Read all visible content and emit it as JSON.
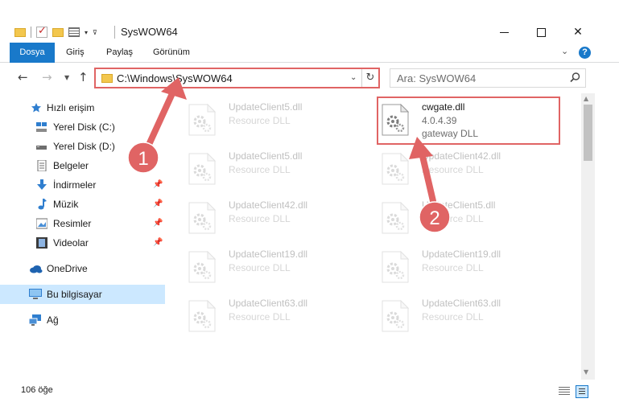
{
  "window": {
    "title": "SysWOW64"
  },
  "ribbon": {
    "tabs": [
      "Dosya",
      "Giriş",
      "Paylaş",
      "Görünüm"
    ]
  },
  "address": {
    "path": "C:\\Windows\\SysWOW64"
  },
  "search": {
    "placeholder": "Ara: SysWOW64"
  },
  "sidebar": {
    "items": [
      {
        "label": "Hızlı erişim",
        "icon": "star-icon",
        "pinned": false
      },
      {
        "label": "Yerel Disk (C:)",
        "icon": "drive-c-icon",
        "pinned": false
      },
      {
        "label": "Yerel Disk (D:)",
        "icon": "drive-icon",
        "pinned": false
      },
      {
        "label": "Belgeler",
        "icon": "documents-icon",
        "pinned": false
      },
      {
        "label": "İndirmeler",
        "icon": "downloads-icon",
        "pinned": true
      },
      {
        "label": "Müzik",
        "icon": "music-icon",
        "pinned": true
      },
      {
        "label": "Resimler",
        "icon": "pictures-icon",
        "pinned": true
      },
      {
        "label": "Videolar",
        "icon": "videos-icon",
        "pinned": true
      },
      {
        "label": "OneDrive",
        "icon": "cloud-icon",
        "pinned": false
      },
      {
        "label": "Bu bilgisayar",
        "icon": "computer-icon",
        "pinned": false,
        "selected": true
      },
      {
        "label": "Ağ",
        "icon": "network-icon",
        "pinned": false
      }
    ]
  },
  "files": {
    "left": [
      {
        "name": "UpdateClient5.dll",
        "type": "Resource DLL"
      },
      {
        "name": "UpdateClient5.dll",
        "type": "Resource DLL"
      },
      {
        "name": "UpdateClient42.dll",
        "type": "Resource DLL"
      },
      {
        "name": "UpdateClient19.dll",
        "type": "Resource DLL"
      },
      {
        "name": "UpdateClient63.dll",
        "type": "Resource DLL"
      }
    ],
    "right": [
      {
        "name": "cwgate.dll",
        "version": "4.0.4.39",
        "type": "gateway DLL",
        "highlighted": true
      },
      {
        "name": "UpdateClient42.dll",
        "type": "Resource DLL"
      },
      {
        "name": "UpdateClient5.dll",
        "type": "Resource DLL"
      },
      {
        "name": "UpdateClient19.dll",
        "type": "Resource DLL"
      },
      {
        "name": "UpdateClient63.dll",
        "type": "Resource DLL"
      }
    ]
  },
  "status": {
    "count": "106 öğe"
  },
  "annotations": {
    "badge1": "1",
    "badge2": "2",
    "color": "#e06464"
  }
}
